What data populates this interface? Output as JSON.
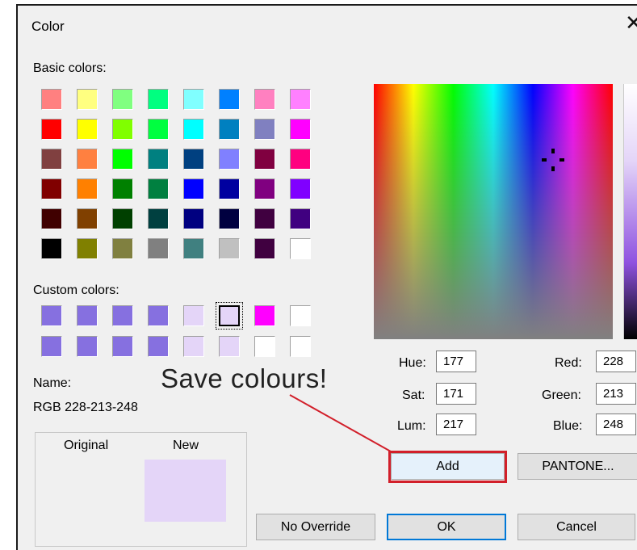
{
  "window": {
    "title": "Color",
    "close_glyph": "✕"
  },
  "basic": {
    "label": "Basic colors:",
    "swatches": [
      "#ff8080",
      "#ffff80",
      "#80ff80",
      "#00ff80",
      "#80ffff",
      "#0080ff",
      "#ff80c0",
      "#ff80ff",
      "#ff0000",
      "#ffff00",
      "#80ff00",
      "#00ff40",
      "#00ffff",
      "#0080c0",
      "#8080c0",
      "#ff00ff",
      "#804040",
      "#ff8040",
      "#00ff00",
      "#008080",
      "#004080",
      "#8080ff",
      "#800040",
      "#ff0080",
      "#800000",
      "#ff8000",
      "#008000",
      "#008040",
      "#0000ff",
      "#0000a0",
      "#800080",
      "#8000ff",
      "#400000",
      "#804000",
      "#004000",
      "#004040",
      "#000080",
      "#000040",
      "#400040",
      "#400080",
      "#000000",
      "#808000",
      "#808040",
      "#808080",
      "#408080",
      "#c0c0c0",
      "#400040",
      "#ffffff"
    ]
  },
  "custom": {
    "label": "Custom colors:",
    "swatches": [
      "#8670e0",
      "#8670e0",
      "#8670e0",
      "#8670e0",
      "#e4d5f8",
      "#e4d5f8",
      "#ff00ff",
      "#ffffff",
      "#8670e0",
      "#8670e0",
      "#8670e0",
      "#8670e0",
      "#e4d5f8",
      "#e4d5f8",
      "#ffffff",
      "#ffffff"
    ],
    "selected_index": 5
  },
  "name": {
    "label": "Name:",
    "value": "RGB 228-213-248"
  },
  "preview": {
    "original_label": "Original",
    "new_label": "New",
    "new_color": "#e4d5f8"
  },
  "fields": {
    "hue": {
      "label": "Hue:",
      "value": "177"
    },
    "sat": {
      "label": "Sat:",
      "value": "171"
    },
    "lum": {
      "label": "Lum:",
      "value": "217"
    },
    "red": {
      "label": "Red:",
      "value": "228"
    },
    "green": {
      "label": "Green:",
      "value": "213"
    },
    "blue": {
      "label": "Blue:",
      "value": "248"
    }
  },
  "buttons": {
    "add": "Add",
    "pantone": "PANTONE...",
    "no_override": "No Override",
    "ok": "OK",
    "cancel": "Cancel"
  },
  "annotation": {
    "text": "Save colours!",
    "color": "#d21f2a"
  }
}
